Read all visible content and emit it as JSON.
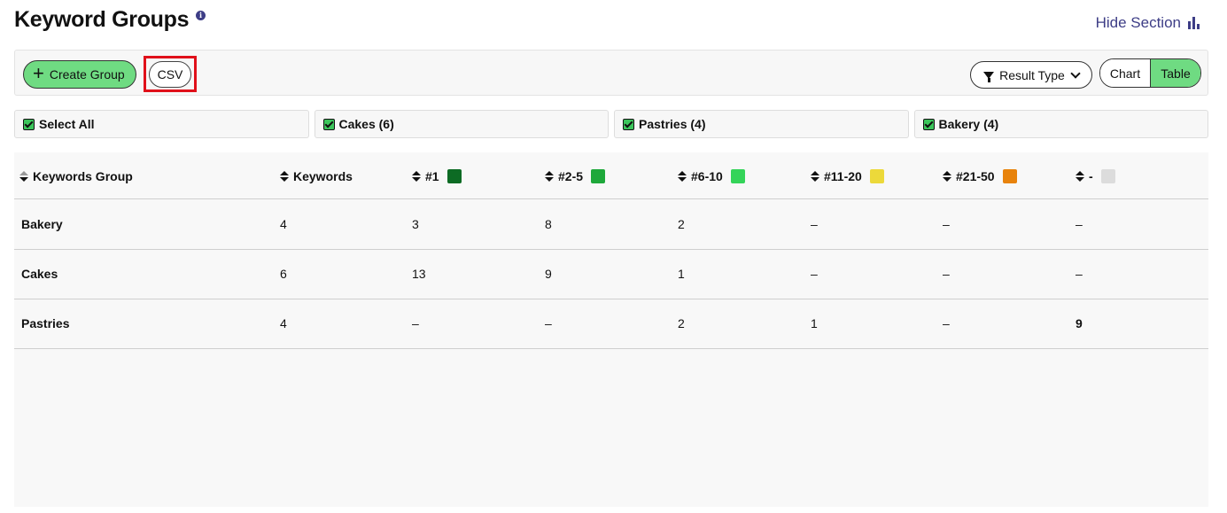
{
  "header": {
    "title": "Keyword Groups",
    "info_glyph": "i",
    "hide_section_label": "Hide Section"
  },
  "toolbar": {
    "create_group_label": "Create Group",
    "csv_label": "CSV",
    "result_type_label": "Result Type",
    "view_toggle": {
      "chart_label": "Chart",
      "table_label": "Table",
      "active": "Table"
    }
  },
  "groups": [
    {
      "label": "Select All",
      "checked": true
    },
    {
      "label": "Cakes (6)",
      "checked": true
    },
    {
      "label": "Pastries (4)",
      "checked": true
    },
    {
      "label": "Bakery (4)",
      "checked": true
    }
  ],
  "table": {
    "columns": [
      {
        "label": "Keywords Group",
        "swatch": null
      },
      {
        "label": "Keywords",
        "swatch": null
      },
      {
        "label": "#1",
        "swatch": "#0d6b24"
      },
      {
        "label": "#2-5",
        "swatch": "#1ea83a"
      },
      {
        "label": "#6-10",
        "swatch": "#34d459"
      },
      {
        "label": "#11-20",
        "swatch": "#ecd93a"
      },
      {
        "label": "#21-50",
        "swatch": "#e8830c"
      },
      {
        "label": "-",
        "swatch": "#dcdcdc"
      }
    ],
    "rows": [
      [
        "Bakery",
        "4",
        "3",
        "8",
        "2",
        "–",
        "–",
        "–"
      ],
      [
        "Cakes",
        "6",
        "13",
        "9",
        "1",
        "–",
        "–",
        "–"
      ],
      [
        "Pastries",
        "4",
        "–",
        "–",
        "2",
        "1",
        "–",
        "9"
      ]
    ]
  },
  "colors": {
    "accent_green": "#6fdb82",
    "brand_navy": "#3d3d86",
    "highlight_red": "#e0101a"
  }
}
